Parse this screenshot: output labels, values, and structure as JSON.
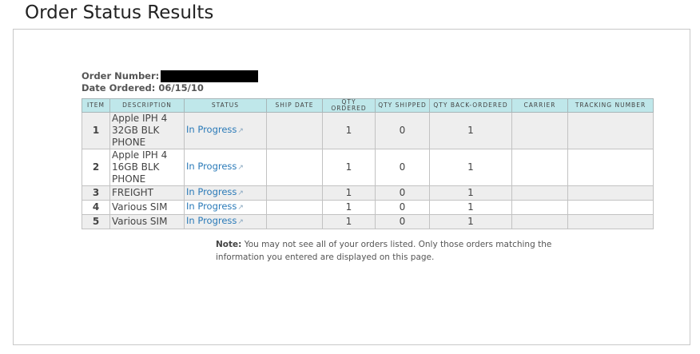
{
  "page": {
    "title": "Order Status Results"
  },
  "order": {
    "number_label": "Order Number:",
    "date_label": "Date Ordered:",
    "date_value": "06/15/10"
  },
  "table": {
    "headers": [
      "ITEM",
      "DESCRIPTION",
      "STATUS",
      "SHIP DATE",
      "QTY ORDERED",
      "QTY SHIPPED",
      "QTY BACK-ORDERED",
      "CARRIER",
      "TRACKING NUMBER"
    ],
    "rows": [
      {
        "item": "1",
        "description": "Apple IPH 4 32GB BLK PHONE",
        "status": "In Progress",
        "ship_date": "",
        "qty_ordered": "1",
        "qty_shipped": "0",
        "qty_back": "1",
        "carrier": "",
        "tracking": ""
      },
      {
        "item": "2",
        "description": "Apple IPH 4 16GB BLK PHONE",
        "status": "In Progress",
        "ship_date": "",
        "qty_ordered": "1",
        "qty_shipped": "0",
        "qty_back": "1",
        "carrier": "",
        "tracking": ""
      },
      {
        "item": "3",
        "description": "FREIGHT",
        "status": "In Progress",
        "ship_date": "",
        "qty_ordered": "1",
        "qty_shipped": "0",
        "qty_back": "1",
        "carrier": "",
        "tracking": ""
      },
      {
        "item": "4",
        "description": "Various SIM",
        "status": "In Progress",
        "ship_date": "",
        "qty_ordered": "1",
        "qty_shipped": "0",
        "qty_back": "1",
        "carrier": "",
        "tracking": ""
      },
      {
        "item": "5",
        "description": "Various SIM",
        "status": "In Progress",
        "ship_date": "",
        "qty_ordered": "1",
        "qty_shipped": "0",
        "qty_back": "1",
        "carrier": "",
        "tracking": ""
      }
    ]
  },
  "note": {
    "label": "Note:",
    "text": "You may not see all of your orders listed. Only those orders matching the information you entered are displayed on this page."
  },
  "icons": {
    "status_link": "external-link-icon"
  },
  "colors": {
    "header_bg": "#bfe7ea",
    "link": "#2a7ab8",
    "row_alt": "#eeeeee",
    "redaction": "#000000"
  }
}
